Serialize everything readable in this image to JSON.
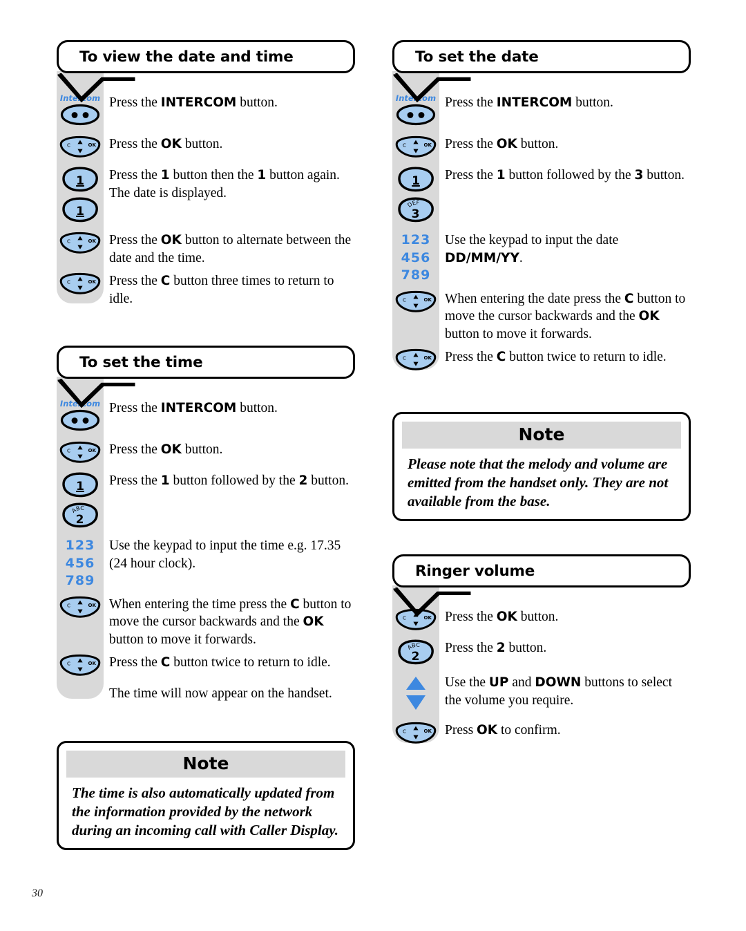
{
  "page": {
    "number": "30",
    "colors": {
      "accent_blue": "#3d88e0",
      "button_fill": "#a8cdf0",
      "strip_grey": "#d9d9d9",
      "ink": "#000000"
    }
  },
  "icons": {
    "intercom_label": "Intercom",
    "intercom": "intercom-button-icon",
    "navigator": "navigator-c-ok-button-icon",
    "nav_left_label": "C",
    "nav_right_label": "OK",
    "key1": "keypad-1-button-icon",
    "key1_label": "1",
    "key2": "keypad-2-abc-button-icon",
    "key2_label": "2",
    "key2_letters": "ABC",
    "key3": "keypad-3-def-button-icon",
    "key3_label": "3",
    "key3_letters": "DEF",
    "keypad_rows": [
      "123",
      "456",
      "789"
    ],
    "up_arrow": "up-arrow-icon",
    "down_arrow": "down-arrow-icon"
  },
  "sections": [
    {
      "id": "view-date-and-time",
      "title": "To view the date and time",
      "column": "left",
      "steps": [
        {
          "icons": [
            "intercom"
          ],
          "text_html": "Press the <b>INTERCOM</b> button."
        },
        {
          "icons": [
            "navigator"
          ],
          "text_html": "Press the <b>OK</b> button."
        },
        {
          "icons": [
            "key1",
            "key1"
          ],
          "text_html": "Press the <b>1</b> button then the <b>1</b> button again. The date is displayed."
        },
        {
          "icons": [
            "navigator"
          ],
          "text_html": "Press the <b>OK</b> button to alternate between the date and the time."
        },
        {
          "icons": [
            "navigator"
          ],
          "text_html": "Press the <b>C</b> button three times to return to idle."
        }
      ]
    },
    {
      "id": "set-the-time",
      "title": "To set the time",
      "column": "left",
      "steps": [
        {
          "icons": [
            "intercom"
          ],
          "text_html": "Press the <b>INTERCOM</b> button."
        },
        {
          "icons": [
            "navigator"
          ],
          "text_html": "Press the <b>OK</b> button."
        },
        {
          "icons": [
            "key1",
            "key2"
          ],
          "text_html": "Press the <b>1</b> button followed by the <b>2</b> button."
        },
        {
          "icons": [
            "keypad"
          ],
          "text_html": "Use the keypad to input the time e.g. 17.35 (24 hour clock)."
        },
        {
          "icons": [
            "navigator"
          ],
          "text_html": "When entering the time press the <b>C</b> button to move the cursor backwards and the <b>OK</b> button to move it forwards."
        },
        {
          "icons": [
            "navigator"
          ],
          "text_html": "Press the <b>C</b> button twice to return to idle."
        },
        {
          "icons": [],
          "text_html": "The time will now appear on the handset."
        }
      ]
    },
    {
      "id": "set-the-date",
      "title": "To set the date",
      "column": "right",
      "steps": [
        {
          "icons": [
            "intercom"
          ],
          "text_html": "Press the <b>INTERCOM</b> button."
        },
        {
          "icons": [
            "navigator"
          ],
          "text_html": "Press the <b>OK</b> button."
        },
        {
          "icons": [
            "key1",
            "key3"
          ],
          "text_html": "Press the <b>1</b> button followed by the <b>3</b> button."
        },
        {
          "icons": [
            "keypad"
          ],
          "text_html": "Use the keypad to input the date <b>DD/MM/YY</b>."
        },
        {
          "icons": [
            "navigator"
          ],
          "text_html": "When entering the date press the <b>C</b> button to move the cursor backwards and the <b>OK</b> button to move it forwards."
        },
        {
          "icons": [
            "navigator"
          ],
          "text_html": "Press the <b>C</b> button twice to return to idle."
        }
      ]
    },
    {
      "id": "ringer-volume",
      "title": "Ringer volume",
      "column": "right",
      "steps": [
        {
          "icons": [
            "navigator"
          ],
          "text_html": "Press the <b>OK</b> button."
        },
        {
          "icons": [
            "key2"
          ],
          "text_html": "Press the <b>2</b> button."
        },
        {
          "icons": [
            "updown"
          ],
          "text_html": "Use the <b>UP</b> and <b>DOWN</b> buttons to select the volume you require."
        },
        {
          "icons": [
            "navigator"
          ],
          "text_html": "Press <b>OK</b> to confirm."
        }
      ]
    }
  ],
  "notes": [
    {
      "id": "note-time",
      "column": "left",
      "heading": "Note",
      "body": "The time is also automatically updated from the information provided by the network during an incoming call with Caller Display."
    },
    {
      "id": "note-melody",
      "column": "right",
      "heading": "Note",
      "body": "Please note that the melody and volume are emitted from the handset only. They are not available from the base."
    }
  ]
}
